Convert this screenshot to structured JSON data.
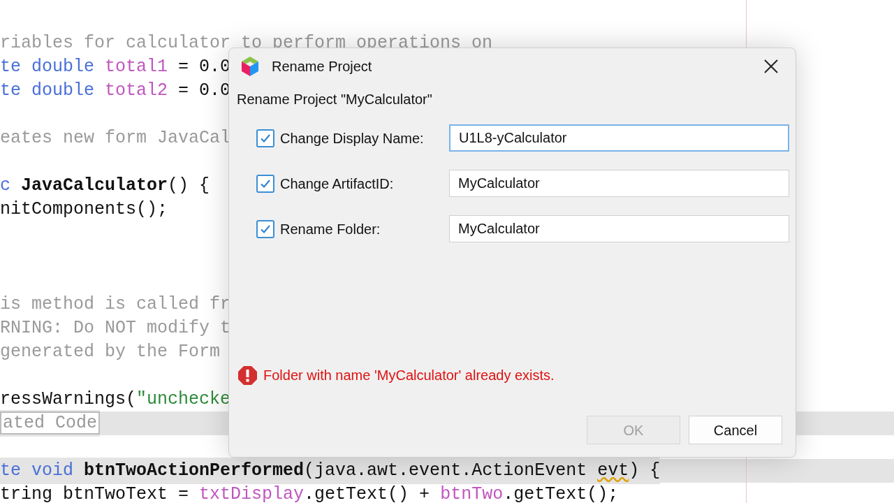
{
  "editor": {
    "lines": [
      {
        "kind": "code",
        "highlighted": false,
        "segments": [
          {
            "kind": "comment",
            "text": "riables for calculator to perform operations on"
          }
        ]
      },
      {
        "kind": "code",
        "highlighted": false,
        "segments": [
          {
            "kind": "keyword",
            "text": "te double "
          },
          {
            "kind": "field",
            "text": "total1"
          },
          {
            "kind": "plain",
            "text": " = 0.0"
          }
        ]
      },
      {
        "kind": "code",
        "highlighted": false,
        "segments": [
          {
            "kind": "keyword",
            "text": "te double "
          },
          {
            "kind": "field",
            "text": "total2"
          },
          {
            "kind": "plain",
            "text": " = 0.0"
          }
        ]
      },
      {
        "kind": "blank"
      },
      {
        "kind": "code",
        "highlighted": false,
        "segments": [
          {
            "kind": "comment",
            "text": "eates new form JavaCal"
          }
        ]
      },
      {
        "kind": "blank"
      },
      {
        "kind": "code",
        "highlighted": false,
        "segments": [
          {
            "kind": "keyword",
            "text": "c "
          },
          {
            "kind": "bold",
            "text": "JavaCalculator"
          },
          {
            "kind": "plain",
            "text": "() {"
          }
        ]
      },
      {
        "kind": "code",
        "highlighted": false,
        "segments": [
          {
            "kind": "plain",
            "text": "nitComponents();"
          }
        ]
      },
      {
        "kind": "blank"
      },
      {
        "kind": "blank"
      },
      {
        "kind": "blank"
      },
      {
        "kind": "code",
        "highlighted": false,
        "segments": [
          {
            "kind": "comment",
            "text": "is method is called fr"
          }
        ]
      },
      {
        "kind": "code",
        "highlighted": false,
        "segments": [
          {
            "kind": "comment",
            "text": "RNING: Do NOT modify t"
          }
        ]
      },
      {
        "kind": "code",
        "highlighted": false,
        "segments": [
          {
            "kind": "comment",
            "text": "generated by the Form"
          }
        ]
      },
      {
        "kind": "blank"
      },
      {
        "kind": "code",
        "highlighted": false,
        "segments": [
          {
            "kind": "plain",
            "text": "ressWarnings("
          },
          {
            "kind": "string",
            "text": "\"unchecke"
          }
        ]
      },
      {
        "kind": "code",
        "highlighted": true,
        "segments": [
          {
            "kind": "fold",
            "text": "ated Code"
          }
        ]
      },
      {
        "kind": "blank"
      },
      {
        "kind": "code",
        "highlighted": true,
        "segments": [
          {
            "kind": "keyword",
            "text": "te void "
          },
          {
            "kind": "bold",
            "text": "btnTwoActionPerformed"
          },
          {
            "kind": "plain",
            "text": "(java.awt.event.ActionEvent "
          },
          {
            "kind": "warning",
            "text": "evt"
          },
          {
            "kind": "plain",
            "text": ") {"
          }
        ]
      },
      {
        "kind": "code",
        "highlighted": false,
        "segments": [
          {
            "kind": "plain",
            "text": "tring btnTwoText = "
          },
          {
            "kind": "field",
            "text": "txtDisplay"
          },
          {
            "kind": "plain",
            "text": ".getText() + "
          },
          {
            "kind": "field",
            "text": "btnTwo"
          },
          {
            "kind": "plain",
            "text": ".getText();"
          }
        ]
      }
    ]
  },
  "dialog": {
    "title": "Rename Project",
    "heading": "Rename Project \"MyCalculator\"",
    "rows": [
      {
        "label": "Change Display Name:",
        "checked": true,
        "value": "U1L8-yCalculator",
        "focused": true
      },
      {
        "label": "Change ArtifactID:",
        "checked": true,
        "value": "MyCalculator",
        "focused": false
      },
      {
        "label": "Rename Folder:",
        "checked": true,
        "value": "MyCalculator",
        "focused": false
      }
    ],
    "error": "Folder with name 'MyCalculator' already exists.",
    "buttons": [
      {
        "label": "OK",
        "disabled": true
      },
      {
        "label": "Cancel",
        "disabled": false
      }
    ]
  }
}
